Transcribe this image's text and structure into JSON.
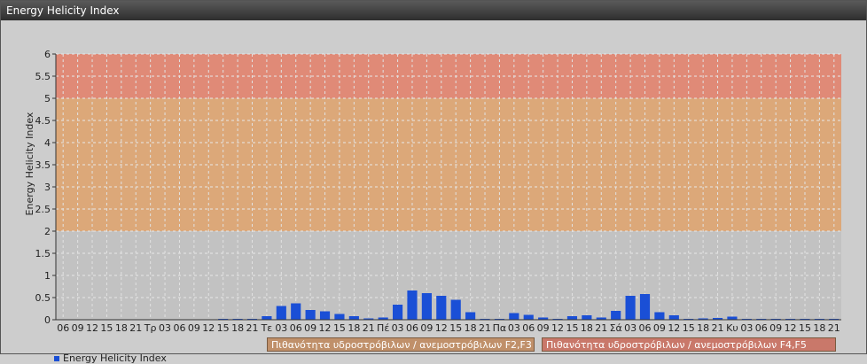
{
  "window": {
    "title": "Energy Helicity Index"
  },
  "legend": {
    "series_label": "Energy Helicity Index",
    "band1_label": "Πιθανότητα υδροστρόβιλων / ανεμοστρόβιλων F2,F3",
    "band2_label": "Πιθανότητα υδροστρόβιλων / ανεμοστρόβιλων F4,F5"
  },
  "colors": {
    "bar": "#1a4fd6",
    "band_low": "#e0a36c",
    "band_high": "#e5806a",
    "band1_legend": "#c0906a",
    "band2_legend": "#c9786a"
  },
  "chart_data": {
    "type": "bar",
    "ylabel": "Energy Helicity Index",
    "xlabel": "",
    "ylim": [
      0,
      6
    ],
    "yticks": [
      "0",
      "0.5",
      "1",
      "1.5",
      "2",
      "2.5",
      "3",
      "3.5",
      "4",
      "4.5",
      "5",
      "5.5",
      "6"
    ],
    "bands": [
      {
        "from": 2,
        "to": 5,
        "label": "Πιθανότητα υδροστρόβιλων / ανεμοστρόβιλων F2,F3"
      },
      {
        "from": 5,
        "to": 6,
        "label": "Πιθανότητα υδροστρόβιλων / ανεμοστρόβιλων F4,F5"
      }
    ],
    "categories": [
      "06",
      "09",
      "12",
      "15",
      "18",
      "21",
      "Τρ",
      "03",
      "06",
      "09",
      "12",
      "15",
      "18",
      "21",
      "Τε",
      "03",
      "06",
      "09",
      "12",
      "15",
      "18",
      "21",
      "Πέ",
      "03",
      "06",
      "09",
      "12",
      "15",
      "18",
      "21",
      "Πα",
      "03",
      "06",
      "09",
      "12",
      "15",
      "18",
      "21",
      "Σά",
      "03",
      "06",
      "09",
      "12",
      "15",
      "18",
      "21",
      "Κυ",
      "03",
      "06",
      "09",
      "12",
      "15",
      "18",
      "21"
    ],
    "series": [
      {
        "name": "Energy Helicity Index",
        "values": [
          0.01,
          0.01,
          0.01,
          0.01,
          0.01,
          0.01,
          0.01,
          0.01,
          0.01,
          0.01,
          0.01,
          0.02,
          0.02,
          0.02,
          0.08,
          0.31,
          0.37,
          0.22,
          0.19,
          0.13,
          0.08,
          0.03,
          0.05,
          0.34,
          0.66,
          0.6,
          0.54,
          0.45,
          0.17,
          0.02,
          0.02,
          0.15,
          0.11,
          0.05,
          0.02,
          0.08,
          0.1,
          0.05,
          0.2,
          0.54,
          0.58,
          0.17,
          0.1,
          0.02,
          0.03,
          0.04,
          0.07,
          0.02,
          0.02,
          0.02,
          0.02,
          0.02,
          0.02,
          0.02
        ]
      }
    ]
  }
}
